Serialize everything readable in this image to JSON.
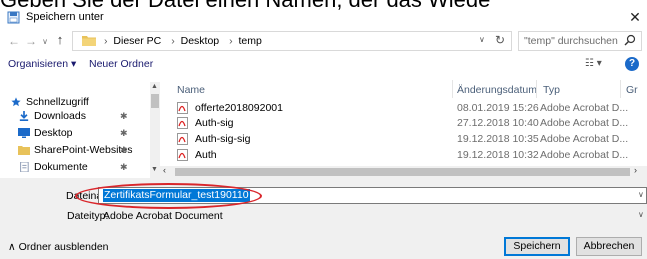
{
  "banner": {
    "text": "Geben Sie der Datei einen Namen, der das Wiede"
  },
  "window": {
    "title": "Speichern unter",
    "close_glyph": "✕"
  },
  "nav_buttons": {
    "back": "←",
    "forward": "→",
    "recent": "∨",
    "up": "↑"
  },
  "address": {
    "crumbs": [
      "Dieser PC",
      "Desktop",
      "temp"
    ],
    "separator": "›",
    "dropdown": "∨",
    "refresh": "↻"
  },
  "search": {
    "placeholder": "\"temp\" durchsuchen"
  },
  "toolbar": {
    "organize": "Organisieren ▾",
    "new_folder": "Neuer Ordner",
    "view": "☷ ▾",
    "help": "?"
  },
  "sidebar": {
    "items": [
      {
        "label": "Schnellzugriff",
        "icon": "star-icon",
        "pinned": false
      },
      {
        "label": "Downloads",
        "icon": "download-icon",
        "pinned": true
      },
      {
        "label": "Desktop",
        "icon": "desktop-icon",
        "pinned": true
      },
      {
        "label": "SharePoint-Websites",
        "icon": "folder-icon",
        "pinned": true
      },
      {
        "label": "Dokumente",
        "icon": "documents-icon",
        "pinned": true
      }
    ],
    "pin_glyph": "✱"
  },
  "file_list": {
    "columns": [
      "Name",
      "Änderungsdatum",
      "Typ",
      "Gr"
    ],
    "rows": [
      {
        "name": "offerte2018092001",
        "date": "08.01.2019 15:26",
        "type": "Adobe Acrobat D..."
      },
      {
        "name": "Auth-sig",
        "date": "27.12.2018 10:40",
        "type": "Adobe Acrobat D..."
      },
      {
        "name": "Auth-sig-sig",
        "date": "19.12.2018 10:35",
        "type": "Adobe Acrobat D..."
      },
      {
        "name": "Auth",
        "date": "19.12.2018 10:32",
        "type": "Adobe Acrobat D..."
      }
    ]
  },
  "scroll": {
    "left": "‹",
    "right": "›",
    "up": "▲",
    "down": "▼"
  },
  "form": {
    "filename_label": "Dateiname:",
    "filename_value": "ZertifikatsFormular_test190110",
    "filetype_label": "Dateityp:",
    "filetype_value": "Adobe Acrobat Document",
    "dropdown": "∨"
  },
  "footer": {
    "hide_folders": "∧  Ordner ausblenden",
    "save": "Speichern",
    "cancel": "Abbrechen"
  },
  "colors": {
    "accent": "#0078d7",
    "highlight_oval": "#d9262b",
    "pdf_red": "#d22"
  }
}
